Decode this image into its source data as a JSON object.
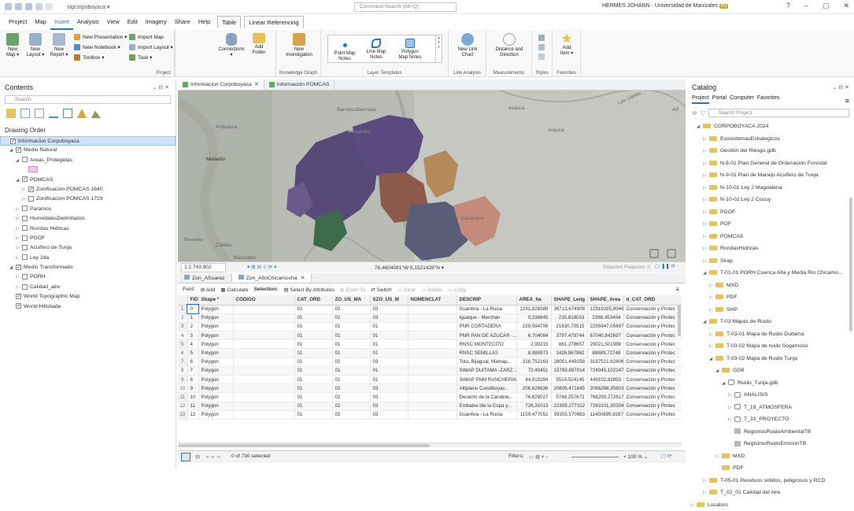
{
  "app": {
    "project_name": "sigcorpoboyaca ▾",
    "command_search": "Command Search (Alt+Q)",
    "user": "HERMES JOHANN - Universidad de Manizales",
    "user_initials": "HJ"
  },
  "menu": [
    "Project",
    "Map",
    "Insert",
    "Analysis",
    "View",
    "Edit",
    "Imagery",
    "Share",
    "Help"
  ],
  "menu_active": "Insert",
  "menu_context": [
    "Table",
    "Linear Referencing"
  ],
  "ribbon": {
    "project": {
      "group": "Project",
      "new_map": "New\nMap ▾",
      "new_layout": "New\nLayout ▾",
      "new_report": "New\nReport ▾",
      "new_presentation": "New Presentation ▾",
      "new_notebook": "New Notebook ▾",
      "toolbox": "Toolbox ▾",
      "import_map": "Import Map",
      "import_layout": "Import Layout ▾",
      "task": "Task ▾",
      "connections": "Connections\n▾",
      "add_folder": "Add\nFolder"
    },
    "knowledge": {
      "group": "Knowledge Graph",
      "new_investigation": "New\nInvestigation"
    },
    "layer_templates": {
      "group": "Layer Templates",
      "point": "Point Map\nNotes",
      "line": "Line Map\nNotes",
      "polygon": "Polygon\nMap Notes"
    },
    "link": {
      "group": "Link Analysis",
      "new_link_chart": "New Link\nChart"
    },
    "measure": {
      "group": "Measurements",
      "distance": "Distance and\nDirection"
    },
    "styles": {
      "group": "Styles"
    },
    "favorites": {
      "group": "Favorites",
      "add_item": "Add\nItem ▾"
    }
  },
  "contents": {
    "title": "Contents",
    "search_placeholder": "Search",
    "drawing_order": "Drawing Order",
    "items": [
      {
        "label": "Informacion Corpoboyaca",
        "indent": 0,
        "check": "on",
        "sel": true
      },
      {
        "label": "Medio Natural",
        "indent": 1,
        "check": "on",
        "exp": "open"
      },
      {
        "label": "Areas_Protegidas",
        "indent": 2,
        "check": "off",
        "exp": "open"
      },
      {
        "label": "",
        "indent": 3,
        "swatch": true
      },
      {
        "label": "POMCAS",
        "indent": 2,
        "check": "on",
        "exp": "open"
      },
      {
        "label": "Zonificación POMCAS 1640",
        "indent": 3,
        "check": "on",
        "exp": "closed"
      },
      {
        "label": "Zonificacion POMCAS 1729",
        "indent": 3,
        "check": "off",
        "exp": "closed"
      },
      {
        "label": "Paramos",
        "indent": 2,
        "check": "off",
        "exp": "closed"
      },
      {
        "label": "HumedalesDelimitados",
        "indent": 2,
        "check": "off",
        "exp": "closed"
      },
      {
        "label": "Rondas Hidricas",
        "indent": 2,
        "check": "off",
        "exp": "closed"
      },
      {
        "label": "PGOF",
        "indent": 2,
        "check": "off",
        "exp": "closed"
      },
      {
        "label": "Acuifero de Tunja",
        "indent": 2,
        "check": "off",
        "exp": "closed"
      },
      {
        "label": "Ley 2da",
        "indent": 2,
        "check": "off",
        "exp": "closed"
      },
      {
        "label": "Medio Transformado",
        "indent": 1,
        "check": "on",
        "exp": "open"
      },
      {
        "label": "PORH",
        "indent": 2,
        "check": "off",
        "exp": "closed"
      },
      {
        "label": "Calidad_aire",
        "indent": 2,
        "check": "off",
        "exp": "closed"
      },
      {
        "label": "World Topographic Map",
        "indent": 1,
        "check": "on"
      },
      {
        "label": "World Hillshade",
        "indent": 1,
        "check": "on"
      }
    ]
  },
  "map": {
    "tabs": [
      "Informacion Corpoboyaca",
      "Información POMCAS"
    ],
    "labels": {
      "barrancabermeja": "Barrancabermeja",
      "santander": "Santander",
      "arauca1": "Arauca",
      "arauca2": "Arauca",
      "llanos": "Los Llanos",
      "antioquia": "Antioquia",
      "medellin": "Medellín",
      "casanare": "Casanare",
      "caldas": "Caldas",
      "manizales": "Manizales",
      "risaralda": "Risaralda",
      "ap": "AP"
    },
    "scale": "1:2.743.902",
    "coords": "76,4604081°W 5,1521428°N ▾",
    "selected_features": "Selected Features: 0"
  },
  "table": {
    "tabs": [
      "Zon_ASuarez",
      "Zon_AltoChicamocha"
    ],
    "toolbar": {
      "field": "Field:",
      "add": "Add",
      "calculate": "Calculate",
      "selection": "Selection:",
      "select_by_attr": "Select By Attributes",
      "zoom_to": "Zoom To",
      "switch": "Switch",
      "clear": "Clear",
      "delete": "Delete",
      "copy": "Copy"
    },
    "columns": [
      "",
      "FID",
      "Shape *",
      "CODIGO",
      "CAT_ORD",
      "ZO_US_MA",
      "SZO_US_M",
      "NOMENCLAT",
      "DESCRIP",
      "AREA_ha",
      "SHAPE_Leng",
      "SHAPE_Area",
      "d_CAT_ORD"
    ],
    "rows": [
      [
        "1",
        "0",
        "Polygon",
        "",
        "01",
        "02",
        "03",
        "",
        "Guantiva - La Rusia",
        "1291,828589",
        "36713,674908",
        "12919285,8946",
        "Conservación y Protec"
      ],
      [
        "2",
        "1",
        "Polygon",
        "",
        "01",
        "02",
        "03",
        "",
        "Iguaque - Merchán",
        "0,238845",
        "235,818033",
        "2388,453404",
        "Conservación y Protec"
      ],
      [
        "3",
        "2",
        "Polygon",
        "",
        "01",
        "01",
        "01",
        "",
        "PNR CORTADERA",
        "229,594706",
        "21830,70515",
        "2295947,05697",
        "Conservación y Protec"
      ],
      [
        "4",
        "3",
        "Polygon",
        "",
        "01",
        "01",
        "01",
        "",
        "PNR PAN DE AZUCAR -...",
        "6,704084",
        "3797,479744",
        "67040,842697",
        "Conservación y Protec"
      ],
      [
        "5",
        "4",
        "Polygon",
        "",
        "01",
        "01",
        "01",
        "",
        "RNSC MONTECITO",
        "2,90215",
        "881,278657",
        "29021,501988",
        "Conservación y Protec"
      ],
      [
        "6",
        "5",
        "Polygon",
        "",
        "01",
        "01",
        "01",
        "",
        "RNSC SEMILLAS",
        "8,888973",
        "1426,867862",
        "88889,72748",
        "Conservación y Protec"
      ],
      [
        "7",
        "6",
        "Polygon",
        "",
        "01",
        "02",
        "03",
        "",
        "Tota, Bijagual, Mamap...",
        "318,752163",
        "28051,449258",
        "3187521,62806",
        "Conservación y Protec"
      ],
      [
        "8",
        "7",
        "Polygon",
        "",
        "01",
        "01",
        "01",
        "",
        "SIMAP DUITAMA -ZARZ...",
        "72,40451",
        "15793,897014",
        "724045,102147",
        "Conservación y Protec"
      ],
      [
        "9",
        "8",
        "Polygon",
        "",
        "01",
        "01",
        "01",
        "",
        "SIMAP PNM RANCHERIA",
        "44,910284",
        "5514,524145",
        "449102,83893",
        "Conservación y Protec"
      ],
      [
        "10",
        "9",
        "Polygon",
        "",
        "01",
        "02",
        "03",
        "",
        "Altiplano Cundiboyac...",
        "206,626836",
        "20606,471645",
        "2066268,35603",
        "Conservación y Protec"
      ],
      [
        "11",
        "10",
        "Polygon",
        "",
        "01",
        "02",
        "03",
        "",
        "Desierto de la Candela...",
        "76,829027",
        "5748,257673",
        "768290,272617",
        "Conservación y Protec"
      ],
      [
        "12",
        "11",
        "Polygon",
        "",
        "01",
        "02",
        "03",
        "",
        "Embalse lde la Copa y...",
        "726,31013",
        "22309,277312",
        "7263101,30304",
        "Conservación y Protec"
      ],
      [
        "13",
        "12",
        "Polygon",
        "",
        "01",
        "02",
        "03",
        "",
        "Guantiva - La Rusia",
        "1159,477052",
        "59355,570983",
        "11450895,8287",
        "Conservación y Protec"
      ]
    ],
    "status": "0 of 730 selected",
    "filters": "Filters:",
    "zoom": "100 %"
  },
  "catalog": {
    "title": "Catalog",
    "tabs": [
      "Project",
      "Portal",
      "Computer",
      "Favorites"
    ],
    "search_placeholder": "Search Project",
    "items": [
      {
        "label": "CORPOBOYACA 2024",
        "indent": 1,
        "exp": "open",
        "icon": "folder"
      },
      {
        "label": "EcosistemasEstrategicos",
        "indent": 2,
        "exp": "closed",
        "icon": "folder"
      },
      {
        "label": "Gestión del Riesgo.gdb",
        "indent": 2,
        "exp": "closed",
        "icon": "folder"
      },
      {
        "label": "N-8-01 Plan General de Ordenación Forestal",
        "indent": 2,
        "exp": "closed",
        "icon": "folder"
      },
      {
        "label": "N-9-01 Plan de Manejo Acuífero de Tunja",
        "indent": 2,
        "exp": "closed",
        "icon": "folder"
      },
      {
        "label": "N-10-01 Ley 2 Magdalena",
        "indent": 2,
        "exp": "closed",
        "icon": "folder"
      },
      {
        "label": "N-10-02 Ley 2 Cocuy",
        "indent": 2,
        "exp": "closed",
        "icon": "folder"
      },
      {
        "label": "PGOF",
        "indent": 2,
        "exp": "closed",
        "icon": "folder"
      },
      {
        "label": "POF",
        "indent": 2,
        "exp": "closed",
        "icon": "folder"
      },
      {
        "label": "POMCAS",
        "indent": 2,
        "exp": "closed",
        "icon": "folder"
      },
      {
        "label": "RondasHídricas",
        "indent": 2,
        "exp": "closed",
        "icon": "folder"
      },
      {
        "label": "Sirap",
        "indent": 2,
        "exp": "closed",
        "icon": "folder"
      },
      {
        "label": "T-01-01 PORH Cuenca Alta y Media Rio Chicamo...",
        "indent": 2,
        "exp": "open",
        "icon": "folder"
      },
      {
        "label": "MXD",
        "indent": 3,
        "exp": "closed",
        "icon": "folder"
      },
      {
        "label": "PDF",
        "indent": 3,
        "exp": "closed",
        "icon": "folder"
      },
      {
        "label": "SHP",
        "indent": 3,
        "exp": "closed",
        "icon": "folder"
      },
      {
        "label": "T-03 Mapas de Ruido",
        "indent": 2,
        "exp": "open",
        "icon": "folder"
      },
      {
        "label": "T-03-01 Mapa de Ruido Duitama",
        "indent": 3,
        "exp": "closed",
        "icon": "folder"
      },
      {
        "label": "T-03-02 Mapa de ruido Sogamoso",
        "indent": 3,
        "exp": "closed",
        "icon": "folder"
      },
      {
        "label": "T-03-02 Mapa de Ruido Tunja",
        "indent": 3,
        "exp": "open",
        "icon": "folder"
      },
      {
        "label": "GDB",
        "indent": 4,
        "exp": "open",
        "icon": "folder"
      },
      {
        "label": "Ruido_Tunja.gdb",
        "indent": 5,
        "exp": "open",
        "icon": "db"
      },
      {
        "label": "ANALISIS",
        "indent": 6,
        "exp": "closed",
        "icon": "db"
      },
      {
        "label": "T_18_ATMOSFERA",
        "indent": 6,
        "exp": "closed",
        "icon": "db"
      },
      {
        "label": "T_33_PROYECTO",
        "indent": 6,
        "exp": "closed",
        "icon": "db"
      },
      {
        "label": "RegistrosRuidoAmbientalTB",
        "indent": 6,
        "icon": "table"
      },
      {
        "label": "RegistrosRuidoEmisionTB",
        "indent": 6,
        "icon": "table"
      },
      {
        "label": "MXD",
        "indent": 4,
        "exp": "closed",
        "icon": "folder"
      },
      {
        "label": "PDF",
        "indent": 4,
        "icon": "folder"
      },
      {
        "label": "T-05-01 Residuos sólidos, peligrosos y RCD",
        "indent": 2,
        "exp": "closed",
        "icon": "folder"
      },
      {
        "label": "T_02_01 Calidad del Aire",
        "indent": 2,
        "exp": "closed",
        "icon": "folder"
      },
      {
        "label": "Locators",
        "indent": 0,
        "exp": "closed",
        "icon": "folder"
      }
    ]
  }
}
